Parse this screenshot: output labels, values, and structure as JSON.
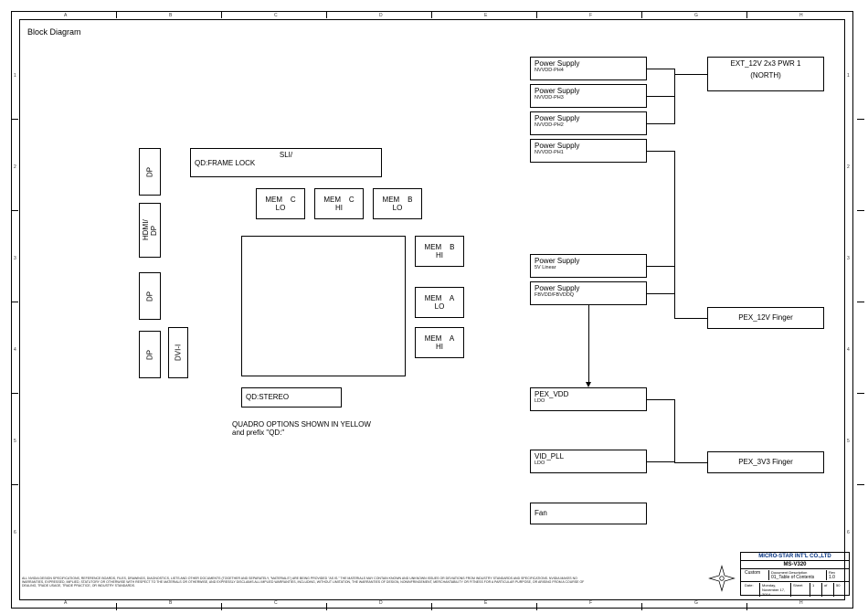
{
  "title": "Block Diagram",
  "ruler": {
    "top": [
      "A",
      "B",
      "C",
      "D",
      "E",
      "F",
      "G",
      "H"
    ],
    "side": [
      "1",
      "2",
      "3",
      "4",
      "5",
      "6"
    ]
  },
  "ports": {
    "dp1": "DP",
    "hdmi_dp": "HDMI/\nDP",
    "dp2": "DP",
    "dp3": "DP",
    "dvi": "DVI-I"
  },
  "sli": {
    "label_top": "SLI/",
    "label_bot": "QD:FRAME LOCK"
  },
  "mem": {
    "c_lo": "MEM    C\nLO",
    "c_hi": "MEM    C\nHI",
    "b_lo": "MEM    B\nLO",
    "b_hi": "MEM    B\nHI",
    "a_lo": "MEM    A\nLO",
    "a_hi": "MEM    A\nHI"
  },
  "stereo": "QD:STEREO",
  "quadro_note": "QUADRO OPTIONS SHOWN IN YELLOW\nand prefix \"QD:\"",
  "ps": {
    "ph4": {
      "t": "Power Supply",
      "s": "NVVDD-PH4"
    },
    "ph3": {
      "t": "Power Supply",
      "s": "NVVDD-PH3"
    },
    "ph2": {
      "t": "Power Supply",
      "s": "NVVDD-PH2"
    },
    "ph1": {
      "t": "Power Supply",
      "s": "NVVDD-PH1"
    },
    "lin": {
      "t": "Power Supply",
      "s": "5V Linear"
    },
    "fb": {
      "t": "Power Supply",
      "s": "FBVDD/FBVDDQ"
    }
  },
  "blocks": {
    "ext12v": "EXT_12V 2x3 PWR 1",
    "ext12v_sub": "(NORTH)",
    "pex12v": "PEX_12V Finger",
    "pex3v3": "PEX_3V3 Finger",
    "pexvdd": "PEX_VDD",
    "pexvdd_sub": "LDO",
    "vidpll": "VID_PLL",
    "vidpll_sub": "LDO",
    "fan": "Fan"
  },
  "disclaimer": "ALL NVIDIA DESIGN SPECIFICATIONS, REFERENCE BOARDS, FILES, DRAWINGS, DIAGNOSTICS, LISTS AND OTHER DOCUMENTS (TOGETHER AND SEPARATELY, \"MATERIALS\") ARE BEING PROVIDED \"AS IS.\" THE MATERIALS MAY CONTAIN KNOWN AND UNKNOWN ISSUES OR DEVIATIONS FROM INDUSTRY STANDARDS AND SPECIFICATIONS. NVIDIA MAKES NO WARRANTIES, EXPRESSED, IMPLIED, STATUTORY OR OTHERWISE WITH RESPECT TO THE MATERIALS OR OTHERWISE, AND EXPRESSLY DISCLAIMS ALL IMPLIED WARRANTIES, INCLUDING, WITHOUT LIMITATION, THE WARRANTIES OF DESIGN, NONINFRINGEMENT, MERCHANTABILITY OR FITNESS FOR A PARTICULAR PURPOSE, OR ARISING FROM A COURSE OF DEALING, TRADE USAGE, TRADE PRACTICE, OR INDUSTRY STANDARDS.",
  "titleblock": {
    "company": "MICRO-STAR INT'L CO.,LTD",
    "model": "MS-V320",
    "desc_label": "Document Description",
    "desc": "01_Table of Contents",
    "size": "Custom",
    "rev_label": "Rev",
    "rev": "1.0",
    "date_label": "Date:",
    "date": "Monday, November 17, 2014",
    "sheet_label": "Sheet",
    "sheet": "1",
    "of_label": "of",
    "of": "50"
  }
}
